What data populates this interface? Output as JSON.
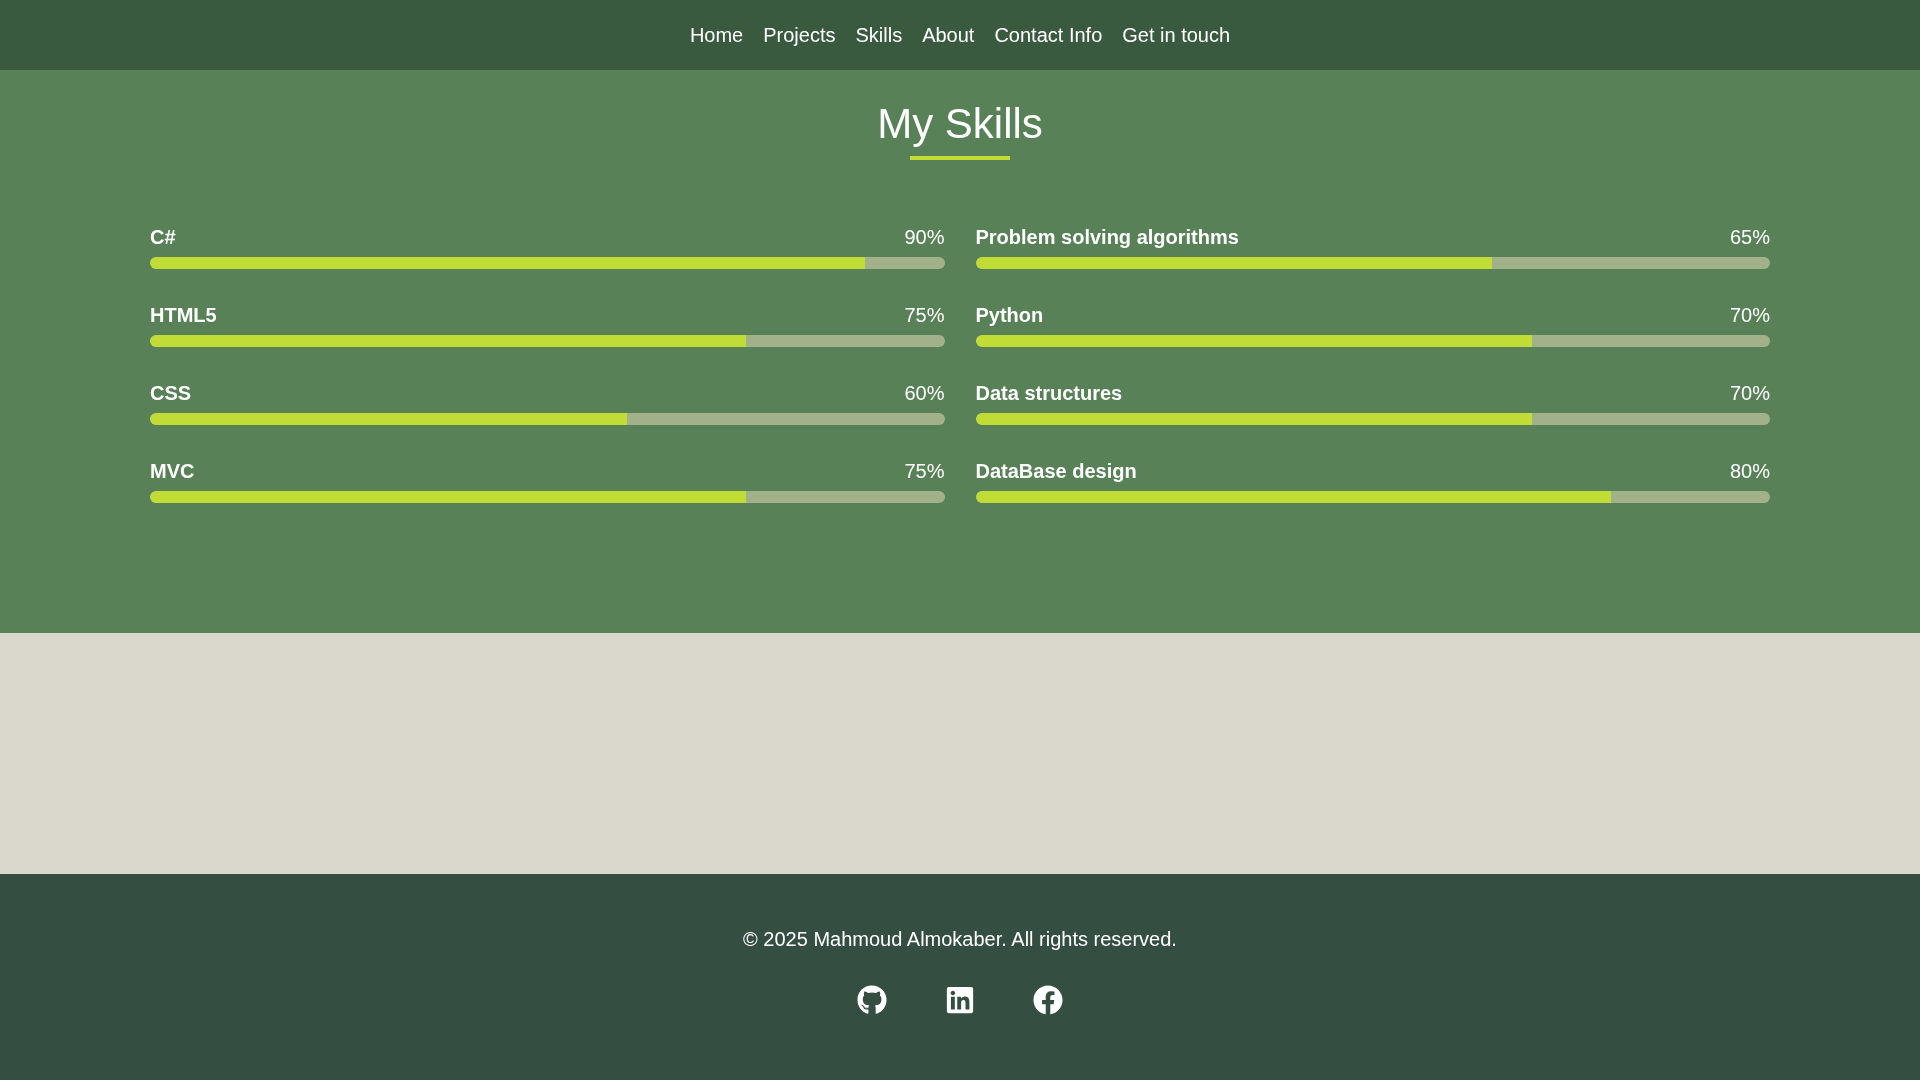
{
  "nav": {
    "links": [
      {
        "label": "Home"
      },
      {
        "label": "Projects"
      },
      {
        "label": "Skills"
      },
      {
        "label": "About"
      },
      {
        "label": "Contact Info"
      },
      {
        "label": "Get in touch"
      }
    ]
  },
  "skills_section": {
    "title": "My Skills",
    "skills": [
      {
        "name": "C#",
        "percent": "90%",
        "level": 0.9
      },
      {
        "name": "Problem solving algorithms",
        "percent": "65%",
        "level": 0.65
      },
      {
        "name": "HTML5",
        "percent": "75%",
        "level": 0.75
      },
      {
        "name": "Python",
        "percent": "70%",
        "level": 0.7
      },
      {
        "name": "CSS",
        "percent": "60%",
        "level": 0.6
      },
      {
        "name": "Data structures",
        "percent": "70%",
        "level": 0.7
      },
      {
        "name": "MVC",
        "percent": "75%",
        "level": 0.75
      },
      {
        "name": "DataBase design",
        "percent": "80%",
        "level": 0.8
      }
    ]
  },
  "footer": {
    "copyright": "© 2025 Mahmoud Almokaber. All rights reserved.",
    "social_links": [
      {
        "kind": "github"
      },
      {
        "kind": "linkedin"
      },
      {
        "kind": "facebook"
      }
    ]
  }
}
